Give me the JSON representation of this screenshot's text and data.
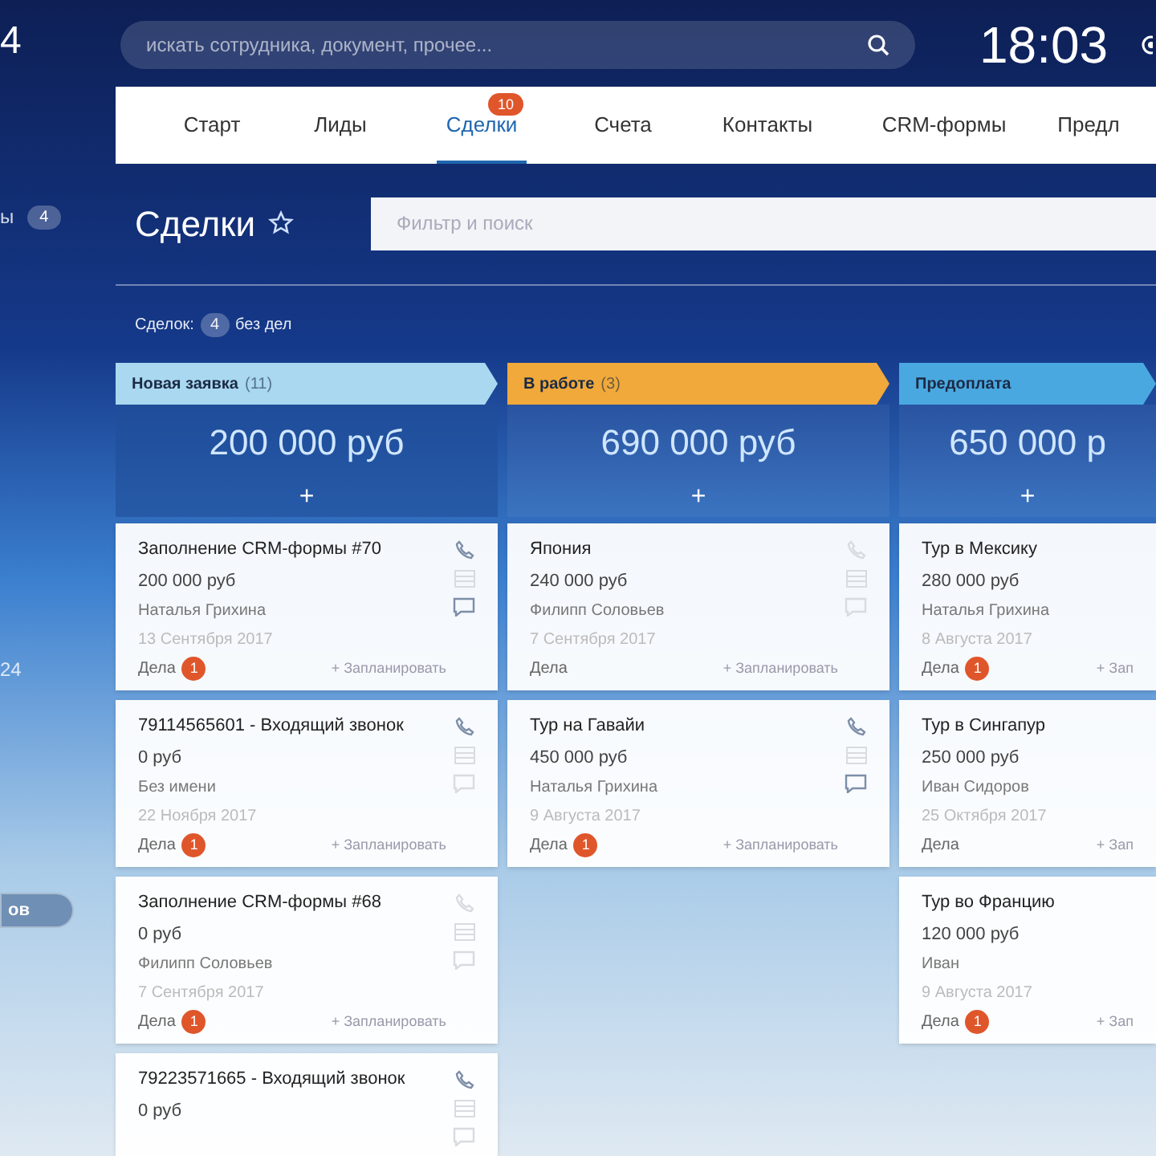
{
  "sidebar": {
    "logo": "4",
    "items": [
      {
        "label": "ы",
        "counter": "4"
      },
      {
        "label": "24"
      }
    ],
    "pill": "ов"
  },
  "header": {
    "search": {
      "placeholder": "искать сотрудника, документ, прочее..."
    },
    "clock": "18:03"
  },
  "tabs": [
    {
      "label": "Старт",
      "selected": false
    },
    {
      "label": "Лиды",
      "selected": false
    },
    {
      "label": "Сделки",
      "selected": true,
      "counter": "10"
    },
    {
      "label": "Счета",
      "selected": false
    },
    {
      "label": "Контакты",
      "selected": false
    },
    {
      "label": "CRM-формы",
      "selected": false
    },
    {
      "label": "Предл",
      "selected": false
    }
  ],
  "page": {
    "title": "Сделки",
    "filter": {
      "placeholder": "Фильтр и поиск"
    },
    "summary": {
      "label": "Сделок:",
      "count": "4",
      "suffix": "без дел"
    }
  },
  "columns": [
    {
      "name": "Новая заявка",
      "count": "(11)",
      "color": "#a9d8f0",
      "sum": "200 000 руб",
      "add": "+",
      "cards": [
        {
          "title": "Заполнение CRM-формы #70",
          "sum": "200 000 руб",
          "contact": "Наталья Грихина",
          "date": "13 Сентября 2017",
          "tasks": "Дела",
          "badge": "1",
          "action": "+ Запланировать",
          "phone_active": true,
          "chat_active": true
        },
        {
          "title": "79114565601 - Входящий звонок",
          "sum": "0 руб",
          "contact": "Без имени",
          "date": "22 Ноября 2017",
          "tasks": "Дела",
          "badge": "1",
          "action": "+ Запланировать",
          "phone_active": true,
          "chat_active": false
        },
        {
          "title": "Заполнение CRM-формы #68",
          "sum": "0 руб",
          "contact": "Филипп Соловьев",
          "date": "7 Сентября 2017",
          "tasks": "Дела",
          "badge": "1",
          "action": "+ Запланировать",
          "phone_active": false,
          "chat_active": false
        },
        {
          "title": "79223571665 - Входящий звонок",
          "sum": "0 руб",
          "phone_active": true,
          "chat_active": false
        }
      ]
    },
    {
      "name": "В работе",
      "count": "(3)",
      "color": "#f0a93a",
      "sum": "690 000 руб",
      "add": "+",
      "cards": [
        {
          "title": "Япония",
          "sum": "240 000 руб",
          "contact": "Филипп Соловьев",
          "date": "7 Сентября 2017",
          "tasks": "Дела",
          "action": "+ Запланировать",
          "phone_active": false,
          "chat_active": false
        },
        {
          "title": "Тур на Гавайи",
          "sum": "450 000 руб",
          "contact": "Наталья Грихина",
          "date": "9 Августа 2017",
          "tasks": "Дела",
          "badge": "1",
          "action": "+ Запланировать",
          "phone_active": true,
          "chat_active": true
        }
      ]
    },
    {
      "name": "Предоплата",
      "color": "#4aa8e0",
      "sum": "650 000 р",
      "add": "+",
      "cards": [
        {
          "title": "Тур в Мексику",
          "sum": "280 000 руб",
          "contact": "Наталья Грихина",
          "date": "8 Августа 2017",
          "tasks": "Дела",
          "badge": "1",
          "action": "+ Зап"
        },
        {
          "title": "Тур в Сингапур",
          "sum": "250 000 руб",
          "contact": "Иван Сидоров",
          "date": "25 Октября 2017",
          "tasks": "Дела",
          "action": "+ Зап"
        },
        {
          "title": "Тур во Францию",
          "sum": "120 000 руб",
          "contact": "Иван",
          "date": "9 Августа 2017",
          "tasks": "Дела",
          "badge": "1",
          "action": "+ Зап"
        }
      ]
    }
  ]
}
